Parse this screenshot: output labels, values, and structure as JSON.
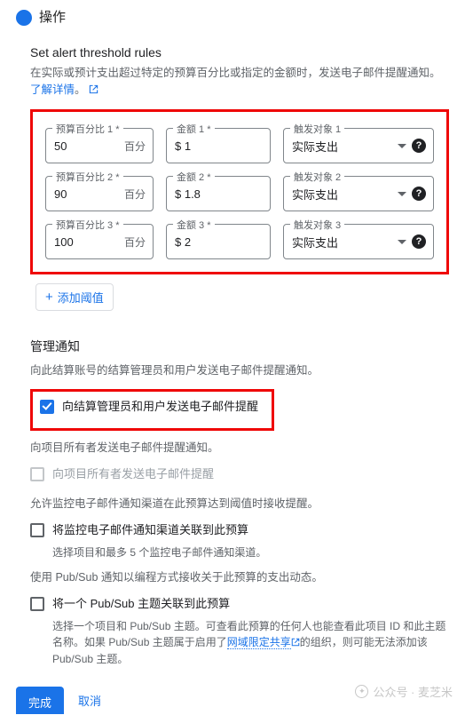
{
  "header": {
    "step_label": "操作"
  },
  "section": {
    "title": "Set alert threshold rules",
    "desc_prefix": "在实际或预计支出超过特定的预算百分比或指定的金额时，发送电子邮件提醒通知。",
    "learn_more": "了解详情"
  },
  "threshold": {
    "rows": [
      {
        "pct_label": "预算百分比 1 *",
        "pct_value": "50",
        "pct_suffix": "百分",
        "amt_label": "金额 1 *",
        "amt_value": "$ 1",
        "trg_label": "触发对象 1",
        "trg_value": "实际支出"
      },
      {
        "pct_label": "预算百分比 2 *",
        "pct_value": "90",
        "pct_suffix": "百分",
        "amt_label": "金额 2 *",
        "amt_value": "$ 1.8",
        "trg_label": "触发对象 2",
        "trg_value": "实际支出"
      },
      {
        "pct_label": "预算百分比 3 *",
        "pct_value": "100",
        "pct_suffix": "百分",
        "amt_label": "金额 3 *",
        "amt_value": "$ 2",
        "trg_label": "触发对象 3",
        "trg_value": "实际支出"
      }
    ],
    "add_label": "添加阈值"
  },
  "notify": {
    "h2": "管理通知",
    "desc1": "向此结算账号的结算管理员和用户发送电子邮件提醒通知。",
    "cb1": "向结算管理员和用户发送电子邮件提醒",
    "desc2": "向项目所有者发送电子邮件提醒通知。",
    "cb2": "向项目所有者发送电子邮件提醒",
    "desc3": "允许监控电子邮件通知渠道在此预算达到阈值时接收提醒。",
    "cb3": "将监控电子邮件通知渠道关联到此预算",
    "cb3_sub": "选择项目和最多 5 个监控电子邮件通知渠道。",
    "desc4": "使用 Pub/Sub 通知以编程方式接收关于此预算的支出动态。",
    "cb4": "将一个 Pub/Sub 主题关联到此预算",
    "cb4_sub_a": "选择一个项目和 Pub/Sub 主题。可查看此预算的任何人也能查看此项目 ID 和此主题名称。如果 Pub/Sub 主题属于启用了",
    "cb4_link": "网域限定共享",
    "cb4_sub_b": "的组织，则可能无法添加该 Pub/Sub 主题。"
  },
  "footer": {
    "done": "完成",
    "cancel": "取消"
  },
  "watermark": "公众号 · 麦芝米"
}
